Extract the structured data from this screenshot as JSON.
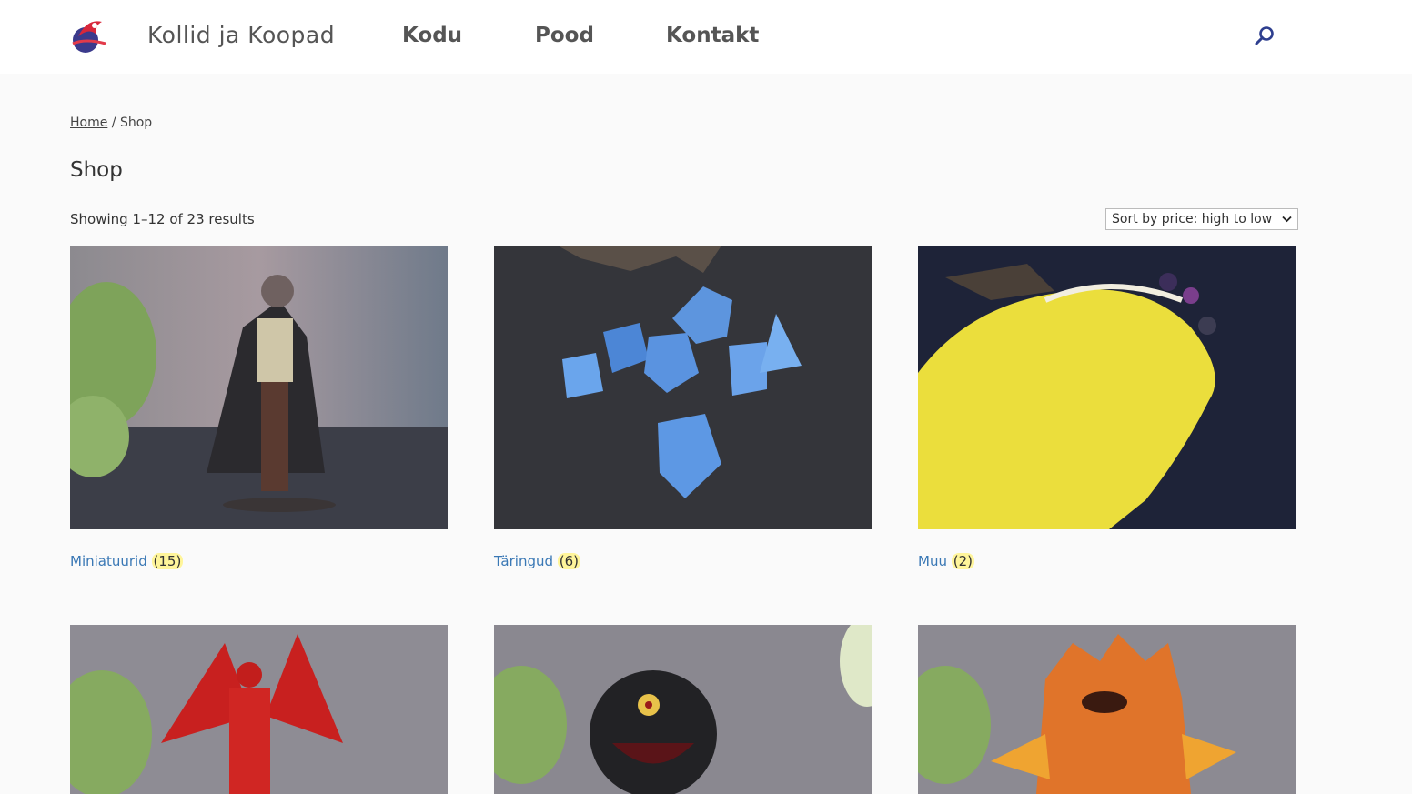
{
  "site": {
    "title": "Kollid ja Koopad",
    "nav": [
      "Kodu",
      "Pood",
      "Kontakt"
    ]
  },
  "breadcrumb": {
    "home": "Home",
    "separator": " / ",
    "current": "Shop"
  },
  "page": {
    "title": "Shop",
    "result_count": "Showing 1–12 of 23 results",
    "sort_selected": "Sort by price: high to low"
  },
  "categories": [
    {
      "name": "Miniatuurid",
      "count": "(15)"
    },
    {
      "name": "Täringud",
      "count": "(6)"
    },
    {
      "name": "Muu",
      "count": "(2)"
    }
  ],
  "colors": {
    "link": "#3a78b5",
    "badge": "#fff59a",
    "nav_text": "#555555",
    "header_bg": "#ffffff",
    "page_bg": "#fafafa"
  },
  "icons": [
    "logo-icon",
    "search-icon",
    "chevron-down-icon"
  ]
}
